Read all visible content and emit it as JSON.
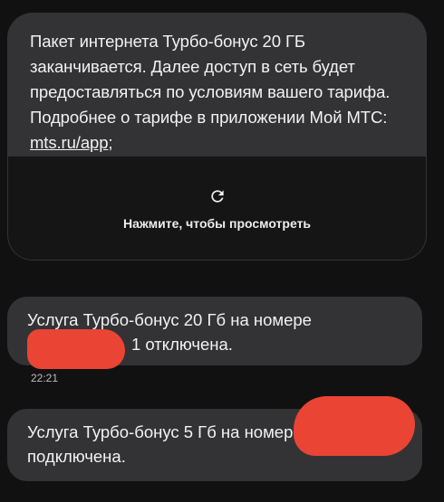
{
  "messages": {
    "m1": {
      "line1": "Пакет интернета  Турбо-бонус 20 ГБ",
      "line2": "заканчивается. Далее доступ в сеть будет",
      "line3": "предоставляться по условиям вашего тарифа.",
      "line4": "Подробнее о тарифе в приложении Мой МТС:",
      "link": "mts.ru/app",
      "link_suffix": ";",
      "preview_icon": "refresh-icon",
      "preview_label": "Нажмите, чтобы просмотреть"
    },
    "m2": {
      "line1": "Услуга Турбо-бонус 20 Гб на номере",
      "line2_suffix": "1 отключена.",
      "time": "22:21"
    },
    "m3": {
      "line1": "Услуга Турбо-бонус 5 Гб на номере",
      "line2": "подключена."
    }
  },
  "colors": {
    "background": "#111112",
    "bubble": "#333335",
    "preview": "#151516",
    "redaction": "#ea4435"
  }
}
